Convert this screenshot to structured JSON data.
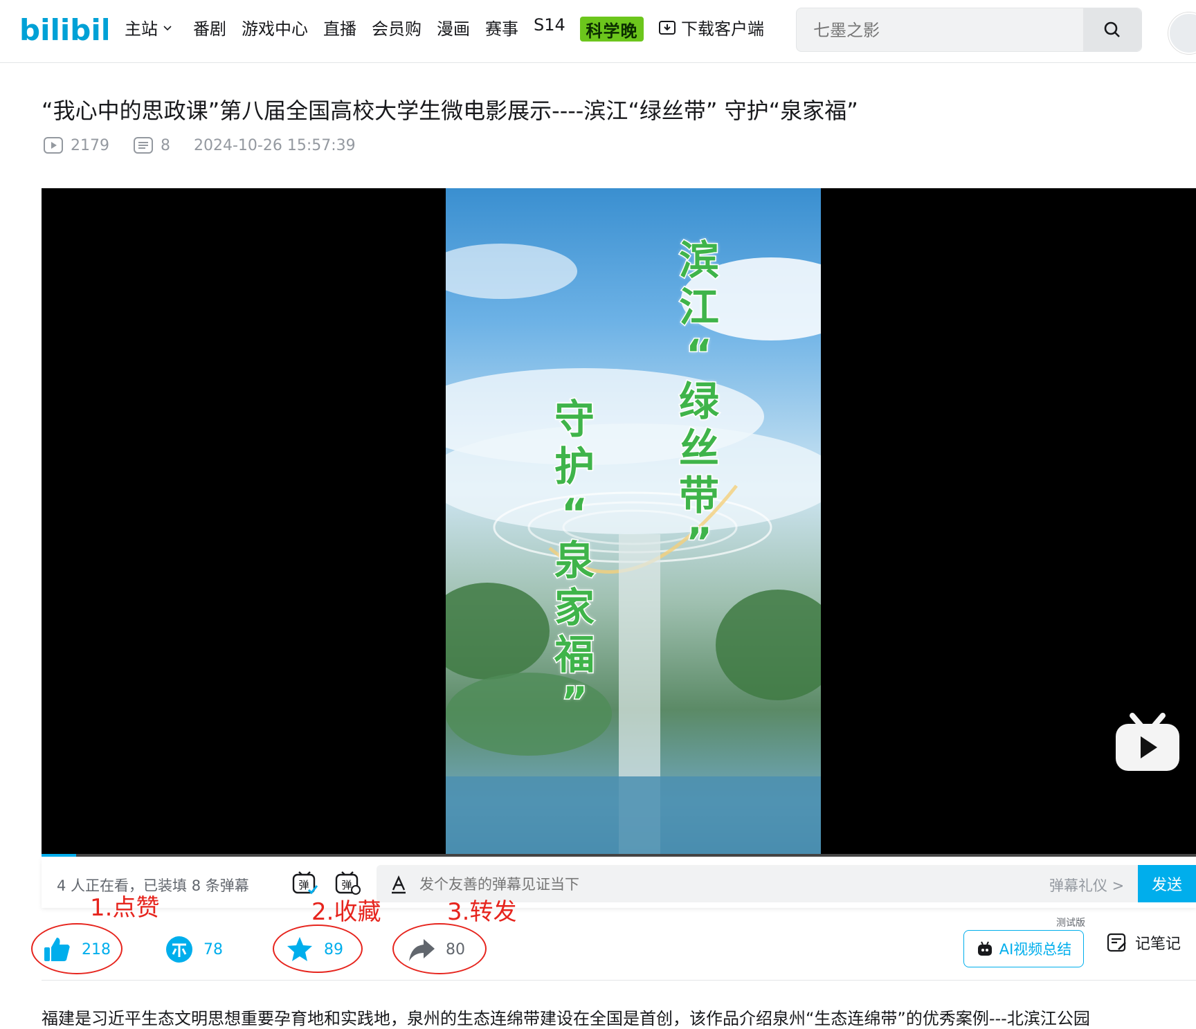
{
  "header": {
    "logo_text": "bilibili",
    "nav": [
      {
        "label": "主站"
      },
      {
        "label": "番剧"
      },
      {
        "label": "游戏中心"
      },
      {
        "label": "直播"
      },
      {
        "label": "会员购"
      },
      {
        "label": "漫画"
      },
      {
        "label": "赛事"
      },
      {
        "label": "S14"
      }
    ],
    "badge_label": "科学晚",
    "download_label": "下载客户端",
    "search_placeholder": "七墨之影"
  },
  "video": {
    "title": "“我心中的思政课”第八届全国高校大学生微电影展示----滨江“绿丝带” 守护“泉家福”",
    "views": "2179",
    "danmaku": "8",
    "date": "2024-10-26 15:57:39",
    "frame_text_col1": [
      "滨",
      "江",
      "“",
      "绿",
      "丝",
      "带",
      "”"
    ],
    "frame_text_col2": [
      "守",
      "护",
      "“",
      "泉",
      "家",
      "福",
      "”"
    ],
    "progress": 0.03
  },
  "danmaku_bar": {
    "status": "4 人正在看，已装填 8 条弹幕",
    "placeholder": "发个友善的弹幕见证当下",
    "etiquette": "弹幕礼仪 >",
    "send_label": "发送",
    "toggle_label": "弹"
  },
  "toolbar": {
    "like": "218",
    "coin": "78",
    "favorite": "89",
    "share": "80",
    "ai_summary": "AI视频总结",
    "ai_badge": "测试版",
    "note": "记笔记"
  },
  "annotations": {
    "a1": "1.点赞",
    "a2": "2.收藏",
    "a3": "3.转发",
    "color": "#e6241d"
  },
  "description": "福建是习近平生态文明思想重要孕育地和实践地，泉州的生态连绵带建设在全国是首创，该作品介绍泉州“生态连绵带”的优秀案例---北滨江公园",
  "colors": {
    "accent": "#00aeec",
    "annotation": "#e6241d"
  }
}
